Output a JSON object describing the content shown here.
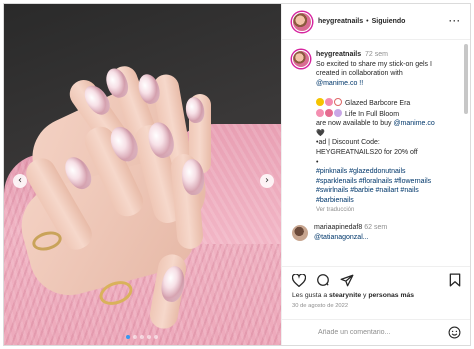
{
  "post": {
    "username": "heygreatnails",
    "separator": "•",
    "follow_label": "Siguiendo",
    "more_label": "···"
  },
  "caption": {
    "username": "heygreatnails",
    "time": "72 sem",
    "lines": [
      "So excited to share my stick-on gels I",
      "created in collaboration with",
      "@manime.co !!"
    ],
    "line_glazed": "Glazed Barbcore Era",
    "line_bloom": "Life In Full Bloom",
    "line_avail_pre": "are now available to buy ",
    "line_avail_link": "@manime.co",
    "line_heart": "🖤",
    "line_ad": "•ad | Discount Code:",
    "line_code": "HEYGREATNAILS20 for 20% off",
    "line_dot": "•",
    "hashtags": [
      "#pinknails #glazeddonutnails",
      "#sparklenails #floralnails #flowernails",
      "#swirlnails #barbie #nailart #nails",
      "#barbienails"
    ],
    "translation": "Ver traducción"
  },
  "comment": {
    "username": "mariaapinedaf8",
    "time": "62 sem",
    "text": "@tatianagonzal..."
  },
  "actions": {
    "likes_pre": "Les gusta a ",
    "likes_user": "stearynite",
    "likes_mid": " y ",
    "likes_post": "personas más",
    "date": "30 de agosto de 2022"
  },
  "add_comment": {
    "placeholder": "Añade un comentario..."
  },
  "media": {
    "prev_icon": "‹",
    "next_icon": "›",
    "slide_count": 5,
    "active_slide": 1
  },
  "colors": {
    "link": "#00376b",
    "accent": "#3897f0",
    "muted": "#8e8e8e",
    "sweater_pink": "#f0b3c3"
  }
}
